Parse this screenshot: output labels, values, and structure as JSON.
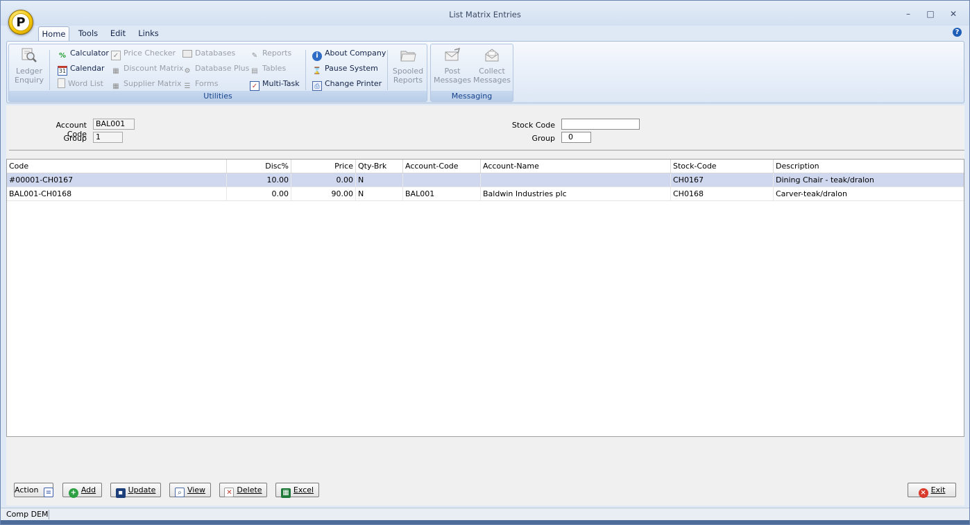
{
  "window": {
    "title": "List Matrix Entries",
    "minimize_glyph": "–",
    "maximize_glyph": "□",
    "close_glyph": "✕"
  },
  "app_logo": "P",
  "ribbon_tabs": [
    {
      "label": "Home",
      "active": true
    },
    {
      "label": "Tools",
      "active": false
    },
    {
      "label": "Edit",
      "active": false
    },
    {
      "label": "Links",
      "active": false
    }
  ],
  "help_glyph": "?",
  "ribbon": {
    "utilities": {
      "label": "Utilities",
      "ledger_enquiry": {
        "line1": "Ledger",
        "line2": "Enquiry",
        "icon": "magnifier-icon",
        "enabled": false
      },
      "col1": [
        {
          "label": "Calculator",
          "icon": "percent-icon",
          "enabled": true
        },
        {
          "label": "Calendar",
          "icon": "calendar-icon",
          "enabled": true
        },
        {
          "label": "Word List",
          "icon": "document-icon",
          "enabled": false
        }
      ],
      "col2": [
        {
          "label": "Price Checker",
          "icon": "checklist-icon",
          "enabled": false
        },
        {
          "label": "Discount Matrix",
          "icon": "matrix-icon",
          "enabled": false
        },
        {
          "label": "Supplier Matrix",
          "icon": "matrix-icon",
          "enabled": false
        }
      ],
      "col3": [
        {
          "label": "Databases",
          "icon": "card-icon",
          "enabled": false
        },
        {
          "label": "Database Plus",
          "icon": "database-plus-icon",
          "enabled": false
        },
        {
          "label": "Forms",
          "icon": "forms-icon",
          "enabled": false
        }
      ],
      "col4": [
        {
          "label": "Reports",
          "icon": "reports-icon",
          "enabled": false
        },
        {
          "label": "Tables",
          "icon": "table-icon",
          "enabled": false
        },
        {
          "label": "Multi-Task",
          "icon": "multitask-icon",
          "enabled": true
        }
      ],
      "col5": [
        {
          "label": "About Company",
          "icon": "info-globe-icon",
          "enabled": true
        },
        {
          "label": "Pause System",
          "icon": "pause-icon",
          "enabled": true
        },
        {
          "label": "Change Printer",
          "icon": "printer-icon",
          "enabled": true
        }
      ],
      "spooled_reports": {
        "line1": "Spooled",
        "line2": "Reports",
        "icon": "folder-icon",
        "enabled": false
      }
    },
    "messaging": {
      "label": "Messaging",
      "post": {
        "line1": "Post",
        "line2": "Messages",
        "icon": "post-envelope-icon",
        "enabled": false
      },
      "collect": {
        "line1": "Collect",
        "line2": "Messages",
        "icon": "open-envelope-icon",
        "enabled": false
      }
    }
  },
  "filters": {
    "account_code_label": "Account Code",
    "account_code_value": "BAL001",
    "group_left_label": "Group",
    "group_left_value": "1",
    "stock_code_label": "Stock Code",
    "stock_code_value": "",
    "group_right_label": "Group",
    "group_right_value": "0"
  },
  "grid": {
    "columns": [
      "Code",
      "Disc%",
      "Price",
      "Qty-Brk",
      "Account-Code",
      "Account-Name",
      "Stock-Code",
      "Description"
    ],
    "rows": [
      {
        "code": "#00001-CH0167",
        "disc": "10.00",
        "price": "0.00",
        "qty_brk": "N",
        "account_code": "",
        "account_name": "",
        "stock_code": "CH0167",
        "description": "Dining Chair - teak/dralon",
        "selected": true
      },
      {
        "code": "BAL001-CH0168",
        "disc": "0.00",
        "price": "90.00",
        "qty_brk": "N",
        "account_code": "BAL001",
        "account_name": "Baldwin Industries plc",
        "stock_code": "CH0168",
        "description": "Carver-teak/dralon",
        "selected": false
      }
    ]
  },
  "buttons": {
    "action": "Action",
    "add": "Add",
    "update": "Update",
    "view": "View",
    "delete": "Delete",
    "excel": "Excel",
    "exit": "Exit"
  },
  "status": {
    "company": "Comp DEM"
  },
  "colors": {
    "accent": "#15428b",
    "selection": "#cfd8ee",
    "ribbon_text": "#15254a",
    "disabled_text": "#9aa0a8"
  }
}
